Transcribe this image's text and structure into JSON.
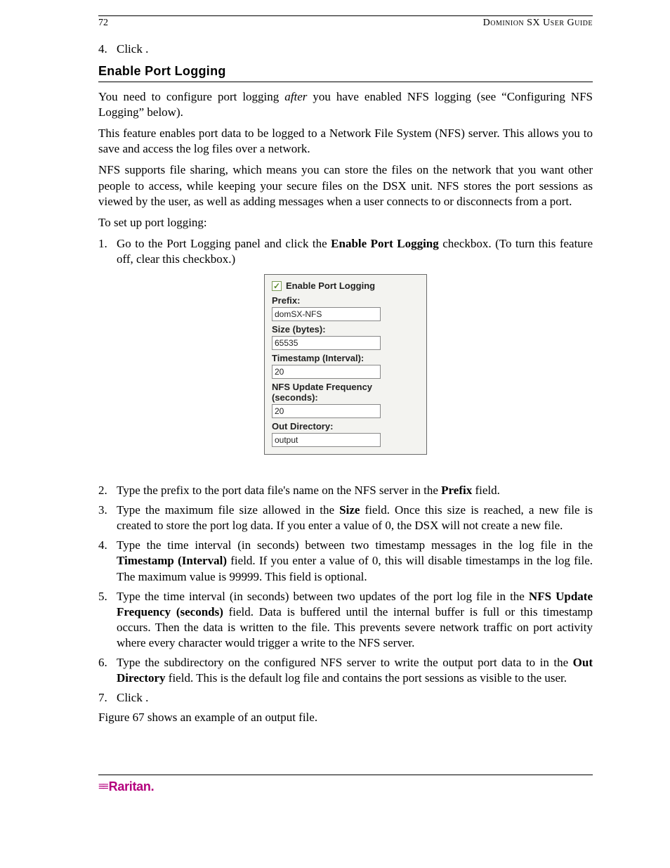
{
  "header": {
    "page_number": "72",
    "guide_title": "Dominion SX User Guide"
  },
  "pre_list": {
    "num": "4.",
    "text": "Click      ."
  },
  "heading": "Enable Port Logging",
  "paras": {
    "p1a": "You need to configure port logging ",
    "p1b": " you have enabled NFS logging (see “Configuring NFS Logging” below).",
    "after_word": "after",
    "p2": "This feature enables port data to be logged to a Network File System (NFS) server. This allows you to save and access the log files over a network.",
    "p3": "NFS supports file sharing, which means you can store the files on the network that you want other people to access, while keeping your secure files on the DSX unit. NFS stores the port sessions as viewed by the user, as well as adding messages when a user connects to or disconnects from a port.",
    "p4": "To set up port logging:"
  },
  "steps": {
    "s1": {
      "num": "1.",
      "a": "Go to the Port Logging panel and click the ",
      "b": " checkbox. (To turn this feature off, clear this checkbox.)",
      "bold": "Enable Port Logging"
    },
    "s2": {
      "num": "2.",
      "a": "Type the prefix to the port data file's name on the NFS server in the ",
      "b": " field.",
      "bold": "Prefix"
    },
    "s3": {
      "num": "3.",
      "a": "Type the maximum file size allowed in the ",
      "b": " field. Once this size is reached, a new file is created to store the port log data. If you enter a value of 0, the DSX will not create a new file.",
      "bold": "Size"
    },
    "s4": {
      "num": "4.",
      "a": "Type the time interval (in seconds) between two timestamp messages in the log file in the ",
      "b": " field. If you enter a value of 0, this will disable timestamps in the log file. The maximum value is 99999. This field is optional.",
      "bold": "Timestamp (Interval)"
    },
    "s5": {
      "num": "5.",
      "a": "Type the time interval (in seconds) between two updates of the port log file in the ",
      "b": " field. Data is buffered until the internal buffer is full or this timestamp occurs. Then the data is written to the file. This prevents severe network traffic on port activity where every character would trigger a write to the NFS server.",
      "bold": "NFS Update Frequency (seconds)"
    },
    "s6": {
      "num": "6.",
      "a": "Type the subdirectory on the configured NFS server to write the output port data to in the ",
      "b": " field. This is the default log file and contains the port sessions as visible to the user.",
      "bold": "Out Directory"
    },
    "s7": {
      "num": "7.",
      "text": "Click      ."
    }
  },
  "closing": "Figure 67 shows an example of an output file.",
  "panel": {
    "checkbox_label": "Enable Port Logging",
    "fields": {
      "prefix": {
        "label": "Prefix:",
        "value": "domSX-NFS"
      },
      "size": {
        "label": "Size (bytes):",
        "value": "65535"
      },
      "timestamp": {
        "label": "Timestamp (Interval):",
        "value": "20"
      },
      "nfs": {
        "label": "NFS Update Frequency (seconds):",
        "value": "20"
      },
      "out": {
        "label": "Out Directory:",
        "value": "output"
      }
    }
  },
  "footer": {
    "brand": "Raritan",
    "dot": "."
  }
}
